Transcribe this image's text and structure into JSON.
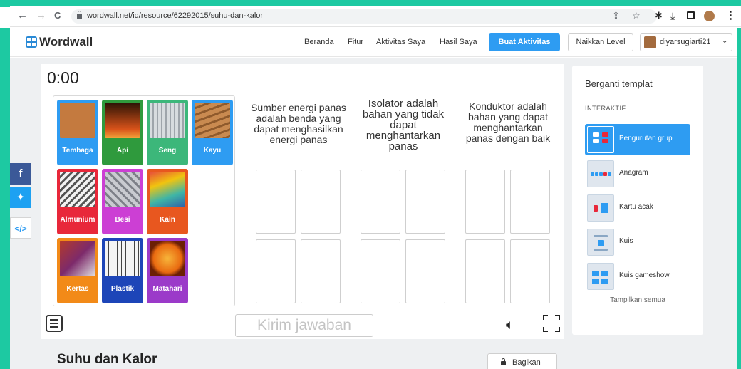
{
  "browser": {
    "url": "wordwall.net/id/resource/62292015/suhu-dan-kalor",
    "back_icon": "←",
    "forward_icon": "→",
    "reload_icon": "C"
  },
  "nav": {
    "logo_text": "Wordwall",
    "links": [
      "Beranda",
      "Fitur",
      "Aktivitas Saya",
      "Hasil Saya"
    ],
    "create_button": "Buat Aktivitas",
    "upgrade_button": "Naikkan Level",
    "username": "diyarsugiarti21"
  },
  "game": {
    "timer": "0:00",
    "tiles": [
      {
        "label": "Tembaga",
        "color": "#2e9cf2",
        "img": "#c47a3f"
      },
      {
        "label": "Api",
        "color": "#2f9a3d",
        "img": "#3a1805"
      },
      {
        "label": "Seng",
        "color": "#3cb77a",
        "img": "#c9cfd3"
      },
      {
        "label": "Kayu",
        "color": "#2e9cf2",
        "img": "#b97d47"
      },
      {
        "label": "Almunium",
        "color": "#e8283a",
        "img": "#e6e6e6"
      },
      {
        "label": "Besi",
        "color": "#cc3fd4",
        "img": "#b6b8bd"
      },
      {
        "label": "Kain",
        "color": "#e8571f",
        "img": "#d9483f"
      },
      {
        "label": "Kertas",
        "color": "#f28a18",
        "img": "#b33a2a"
      },
      {
        "label": "Plastik",
        "color": "#1d45b8",
        "img": "#eeeeee"
      },
      {
        "label": "Matahari",
        "color": "#9b3ac9",
        "img": "#e96a10"
      }
    ],
    "columns": [
      "Sumber energi panas adalah benda yang dapat menghasilkan energi panas",
      "Isolator adalah bahan yang tidak dapat menghantarkan panas",
      "Konduktor adalah bahan yang dapat menghantarkan panas dengan baik"
    ],
    "submit_button": "Kirim jawaban"
  },
  "templates": {
    "title": "Berganti templat",
    "section": "INTERAKTIF",
    "items": [
      "Pengurutan grup",
      "Anagram",
      "Kartu acak",
      "Kuis",
      "Kuis gameshow"
    ],
    "show_all": "Tampilkan semua"
  },
  "activity": {
    "title": "Suhu dan Kalor",
    "share_button": "Bagikan"
  },
  "colors": {
    "teal_frame": "#1dc9a2",
    "accent_blue": "#2e9cf2",
    "facebook": "#3b5998",
    "twitter": "#1da1f2",
    "embed": "#ffffff"
  },
  "icons": {
    "menu": "menu-icon",
    "speaker": "speaker-icon",
    "fullscreen": "fullscreen-icon"
  }
}
